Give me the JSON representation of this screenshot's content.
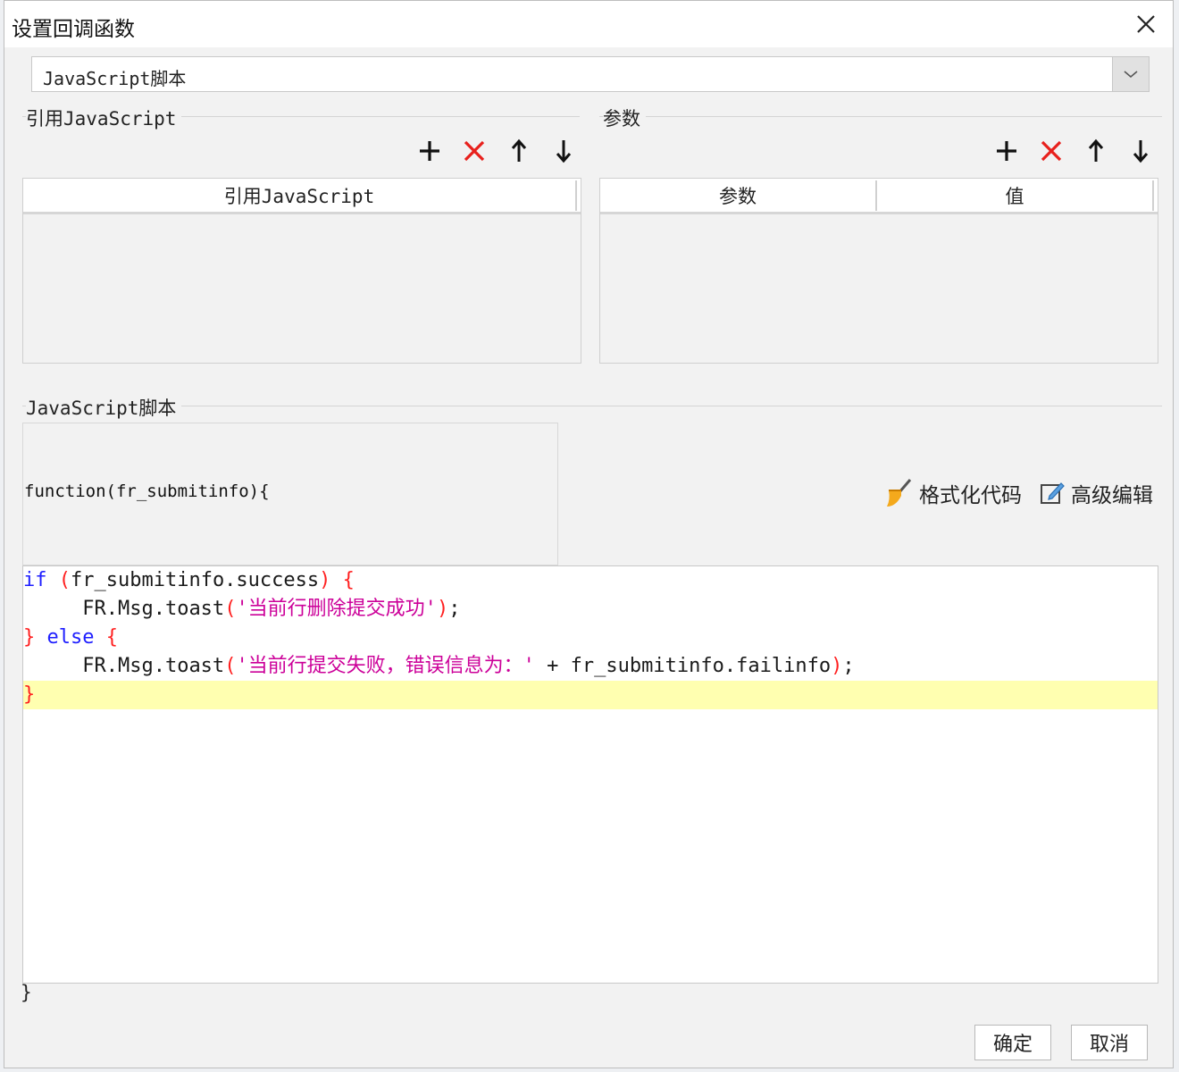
{
  "window": {
    "title": "设置回调函数"
  },
  "type_select": {
    "value": "JavaScript脚本"
  },
  "ref_group": {
    "label": "引用JavaScript",
    "column": "引用JavaScript"
  },
  "param_group": {
    "label": "参数",
    "columns": [
      "参数",
      "值"
    ]
  },
  "script_group": {
    "label": "JavaScript脚本",
    "signature": "function(fr_submitinfo){",
    "closing": "}",
    "format_label": "格式化代码",
    "advanced_label": "高级编辑"
  },
  "code": {
    "line1": {
      "kw": "if",
      "sp": " ",
      "p1": "(",
      "body": "fr_submitinfo.success",
      "p2": ")",
      "sp2": " ",
      "brace": "{"
    },
    "line2": {
      "indent": "     ",
      "call": "FR.Msg.toast",
      "p1": "(",
      "str": "'当前行删除提交成功'",
      "p2": ")",
      "end": ";"
    },
    "line3": {
      "b1": "}",
      "sp": " ",
      "kw": "else",
      "sp2": " ",
      "b2": "{"
    },
    "line4": {
      "indent": "     ",
      "call": "FR.Msg.toast",
      "p1": "(",
      "str": "'当前行提交失败，错误信息为：'",
      "plus": " + fr_submitinfo.failinfo",
      "p2": ")",
      "end": ";"
    },
    "line5": {
      "brace": "}"
    }
  },
  "footer": {
    "ok": "确定",
    "cancel": "取消"
  },
  "colors": {
    "keyword": "#1f1fff",
    "paren": "#ff1f1f",
    "string": "#cc0099",
    "highlight": "#ffffb0"
  }
}
